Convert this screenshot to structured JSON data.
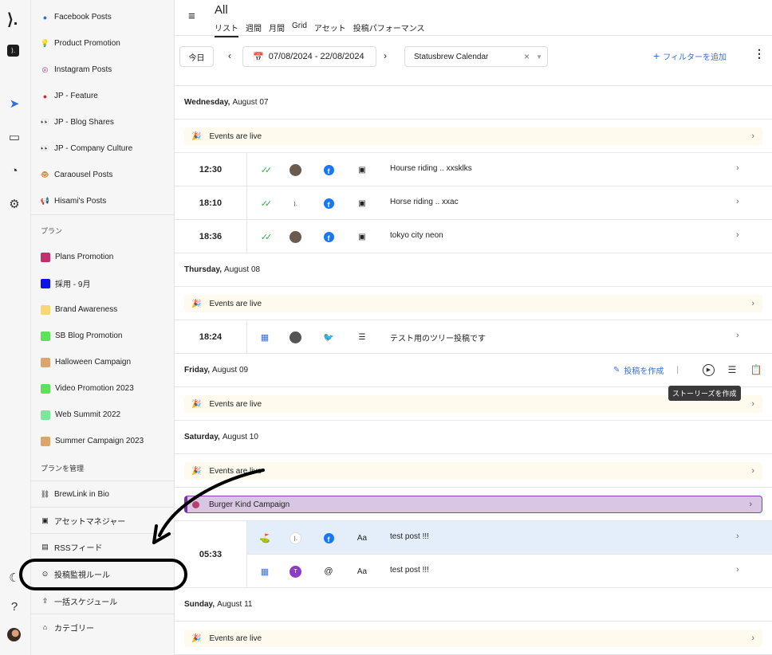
{
  "rail": {
    "icons": [
      "logo-icon",
      "app-icon",
      "send-icon",
      "inbox-icon",
      "analytics-icon",
      "settings-icon",
      "moon-icon",
      "help-icon",
      "avatar"
    ]
  },
  "sidebar": {
    "top_items": [
      {
        "label": "Facebook Posts",
        "icon": "facebook-icon"
      },
      {
        "label": "Product Promotion",
        "icon": "bulb-icon"
      },
      {
        "label": "Instagram Posts",
        "icon": "instagram-icon"
      },
      {
        "label": "JP - Feature",
        "icon": "flag-icon"
      },
      {
        "label": "JP - Blog Shares",
        "icon": "eyes-icon"
      },
      {
        "label": "JP - Company Culture",
        "icon": "eyes-icon"
      },
      {
        "label": "Caraousel Posts",
        "icon": "monkey-icon"
      },
      {
        "label": "Hisami's Posts",
        "icon": "megaphone-icon"
      }
    ],
    "plans_heading": "プラン",
    "plans": [
      {
        "label": "Plans Promotion",
        "color": "#c4306e"
      },
      {
        "label": "採用 - 9月",
        "color": "#0a12e8"
      },
      {
        "label": "Brand Awareness",
        "color": "#f7d774"
      },
      {
        "label": "SB Blog Promotion",
        "color": "#5ce35a"
      },
      {
        "label": "Halloween Campaign",
        "color": "#dba56c"
      },
      {
        "label": "Video Promotion 2023",
        "color": "#5ce35a"
      },
      {
        "label": "Web Summit 2022",
        "color": "#79e89a"
      },
      {
        "label": "Summer Campaign 2023",
        "color": "#dba56c"
      }
    ],
    "manage_label": "プランを管理",
    "tools": [
      {
        "label": "BrewLink in Bio",
        "icon": "link-icon"
      },
      {
        "label": "アセットマネジャー",
        "icon": "image-icon"
      },
      {
        "label": "RSSフィード",
        "icon": "rss-icon"
      },
      {
        "label": "投稿監視ルール",
        "icon": "monitor-rule-icon"
      },
      {
        "label": "一括スケジュール",
        "icon": "upload-icon"
      },
      {
        "label": "カテゴリー",
        "icon": "tag-icon"
      }
    ]
  },
  "header": {
    "title": "All",
    "tabs": [
      "リスト",
      "週間",
      "月間",
      "Grid",
      "アセット",
      "投稿パフォーマンス"
    ],
    "active_tab": "リスト"
  },
  "toolbar": {
    "today": "今日",
    "date_range": "07/08/2024 - 22/08/2024",
    "calendar": "Statusbrew Calendar",
    "add_filter": "フィルターを追加"
  },
  "days": [
    {
      "weekday": "Wednesday,",
      "date": "August 07"
    },
    {
      "weekday": "Thursday,",
      "date": "August 08"
    },
    {
      "weekday": "Friday,",
      "date": "August 09"
    },
    {
      "weekday": "Saturday,",
      "date": "August 10"
    },
    {
      "weekday": "Sunday,",
      "date": "August 11"
    }
  ],
  "event_label": "Events are live",
  "campaign_label": "Burger Kind Campaign",
  "posts": [
    {
      "time": "12:30",
      "status": "double-check-icon",
      "avatar": "avatar-photo",
      "network": "facebook-icon",
      "type": "image-post-icon",
      "text": "Hourse riding .. xxsklks"
    },
    {
      "time": "18:10",
      "status": "double-check-icon",
      "avatar": "avatar-logo",
      "network": "facebook-icon",
      "type": "image-post-icon",
      "text": "Horse riding .. xxac"
    },
    {
      "time": "18:36",
      "status": "double-check-icon",
      "avatar": "avatar-photo",
      "network": "facebook-icon",
      "type": "image-post-icon",
      "text": "tokyo city neon"
    },
    {
      "time": "18:24",
      "status": "calendar-icon",
      "avatar": "avatar-photo",
      "network": "twitter-icon",
      "type": "thread-icon",
      "text": "テスト用のツリー投稿です"
    },
    {
      "time": "05:33",
      "status": "approval-stamp-icon",
      "avatar": "avatar-logo",
      "network": "facebook-icon",
      "type_label": "Aa",
      "text": "test post !!!"
    },
    {
      "status": "calendar-icon",
      "avatar_letter": "T",
      "network": "threads-icon",
      "type_label": "Aa",
      "text": "test post !!!"
    }
  ],
  "day_actions": {
    "create_post": "投稿を作成",
    "tooltip": "ストーリーズを作成"
  }
}
